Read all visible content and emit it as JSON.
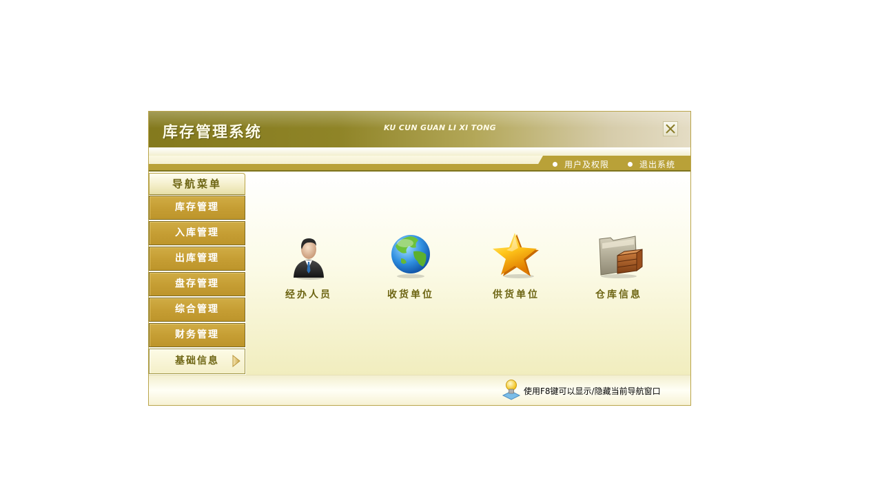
{
  "window": {
    "title": "库存管理系统",
    "subtitle": "KU CUN GUAN LI XI TONG",
    "close_icon": "close-icon"
  },
  "top_links": [
    {
      "label": "用户及权限"
    },
    {
      "label": "退出系统"
    }
  ],
  "sidebar": {
    "header": "导航菜单",
    "items": [
      {
        "label": "库存管理",
        "active": false
      },
      {
        "label": "入库管理",
        "active": false
      },
      {
        "label": "出库管理",
        "active": false
      },
      {
        "label": "盘存管理",
        "active": false
      },
      {
        "label": "综合管理",
        "active": false
      },
      {
        "label": "财务管理",
        "active": false
      },
      {
        "label": "基础信息",
        "active": true
      }
    ]
  },
  "main": {
    "tiles": [
      {
        "label": "经办人员",
        "icon": "businessman-icon"
      },
      {
        "label": "收货单位",
        "icon": "globe-icon"
      },
      {
        "label": "供货单位",
        "icon": "star-icon"
      },
      {
        "label": "仓库信息",
        "icon": "folder-box-icon"
      }
    ]
  },
  "footer": {
    "hint": "使用F8键可以显示/隐藏当前导航窗口",
    "icon": "lightbulb-icon"
  },
  "colors": {
    "accent_gold": "#c59d33",
    "title_olive": "#847a1e",
    "label_text": "#6d6513"
  }
}
